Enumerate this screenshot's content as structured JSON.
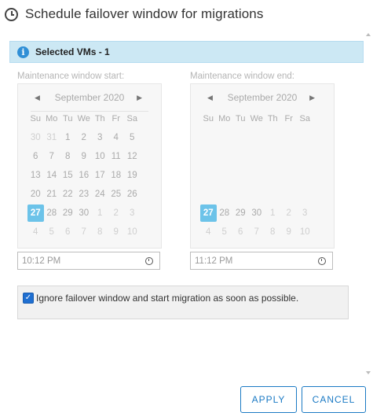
{
  "dialog": {
    "title": "Schedule failover window for migrations"
  },
  "banner": {
    "text": "Selected VMs - 1"
  },
  "start": {
    "label": "Maintenance window start:",
    "month_label": "September 2020",
    "weekdays": [
      "Su",
      "Mo",
      "Tu",
      "We",
      "Th",
      "Fr",
      "Sa"
    ],
    "weeks": [
      [
        "30",
        "31",
        "1",
        "2",
        "3",
        "4",
        "5"
      ],
      [
        "6",
        "7",
        "8",
        "9",
        "10",
        "11",
        "12"
      ],
      [
        "13",
        "14",
        "15",
        "16",
        "17",
        "18",
        "19"
      ],
      [
        "20",
        "21",
        "22",
        "23",
        "24",
        "25",
        "26"
      ],
      [
        "27",
        "28",
        "29",
        "30",
        "1",
        "2",
        "3"
      ],
      [
        "4",
        "5",
        "6",
        "7",
        "8",
        "9",
        "10"
      ]
    ],
    "selected_day": "27",
    "time": "10:12 PM"
  },
  "end": {
    "label": "Maintenance window end:",
    "month_label": "September 2020",
    "weekdays": [
      "Su",
      "Mo",
      "Tu",
      "We",
      "Th",
      "Fr",
      "Sa"
    ],
    "weeks": [
      [
        "",
        "",
        "",
        "",
        "",
        "",
        ""
      ],
      [
        "",
        "",
        "",
        "",
        "",
        "",
        ""
      ],
      [
        "",
        "",
        "",
        "",
        "",
        "",
        ""
      ],
      [
        "",
        "",
        "",
        "",
        "",
        "",
        ""
      ],
      [
        "27",
        "28",
        "29",
        "30",
        "1",
        "2",
        "3"
      ],
      [
        "4",
        "5",
        "6",
        "7",
        "8",
        "9",
        "10"
      ]
    ],
    "selected_day": "27",
    "time": "11:12 PM"
  },
  "ignore": {
    "checked": true,
    "label": "Ignore failover window and start migration as soon as possible."
  },
  "buttons": {
    "apply": "APPLY",
    "cancel": "CANCEL"
  },
  "colors": {
    "accent": "#1b7ac4",
    "selected_day": "#6cc3e9",
    "banner_bg": "#cce8f4",
    "checkbox": "#1f6fd1"
  }
}
